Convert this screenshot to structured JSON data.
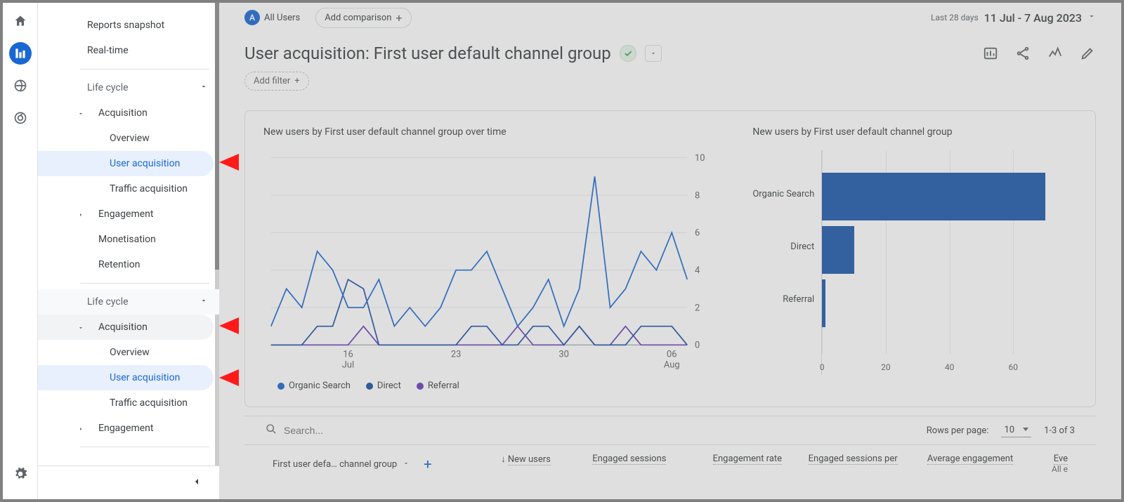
{
  "iconbar": {
    "home": "home-icon",
    "reports": "bar-chart-icon",
    "explore": "globe-trend-icon",
    "target": "target-icon",
    "settings": "gear-icon"
  },
  "sidebar": {
    "items": [
      {
        "label": "Reports snapshot",
        "level": 1,
        "selected": false,
        "interact": true
      },
      {
        "label": "Real-time",
        "level": 1,
        "selected": false,
        "interact": true
      }
    ],
    "group1": {
      "header": "Life cycle",
      "acquisition": "Acquisition",
      "overview": "Overview",
      "user_acq": "User acquisition",
      "traffic_acq": "Traffic acquisition",
      "engagement": "Engagement",
      "monetisation": "Monetisation",
      "retention": "Retention"
    },
    "group2": {
      "header": "Life cycle",
      "acquisition": "Acquisition",
      "overview": "Overview",
      "user_acq": "User acquisition",
      "traffic_acq": "Traffic acquisition",
      "engagement": "Engagement"
    }
  },
  "top": {
    "all_users_badge": "A",
    "all_users_label": "All Users",
    "add_comparison": "Add comparison",
    "date_label": "Last 28 days",
    "date_range": "11 Jul - 7 Aug 2023"
  },
  "title": {
    "text": "User acquisition: First user default channel group",
    "add_filter": "Add filter"
  },
  "chart_data": [
    {
      "type": "line",
      "title": "New users by First user default channel group over time",
      "x_ticks": [
        "16 Jul",
        "23",
        "30",
        "06 Aug"
      ],
      "ylim": [
        0,
        10
      ],
      "y_ticks": [
        0,
        2,
        4,
        6,
        8,
        10
      ],
      "series": [
        {
          "name": "Organic Search",
          "color": "#1967d2",
          "values": [
            1,
            3,
            2,
            5,
            4,
            2,
            2,
            3.5,
            1,
            2,
            1,
            2,
            4,
            4,
            5,
            3,
            1,
            2,
            3.5,
            1,
            3,
            9,
            2,
            3,
            5,
            4,
            6,
            3.5
          ]
        },
        {
          "name": "Direct",
          "color": "#174ea6",
          "values": [
            0,
            0,
            0,
            1,
            1,
            3.5,
            3,
            0,
            0,
            0,
            0,
            0,
            0,
            1,
            1,
            0,
            0,
            1,
            1,
            0,
            1,
            0,
            0,
            0,
            1,
            1,
            1,
            0
          ]
        },
        {
          "name": "Referral",
          "color": "#673ab7",
          "values": [
            0,
            0,
            0,
            0,
            0,
            0,
            1,
            0,
            0,
            0,
            0,
            0,
            0,
            0,
            0,
            0,
            1,
            0,
            0,
            0,
            1,
            0,
            0,
            1,
            0,
            0,
            0,
            0
          ]
        }
      ]
    },
    {
      "type": "bar",
      "title": "New users by First user default channel group",
      "categories": [
        "Organic Search",
        "Direct",
        "Referral"
      ],
      "values": [
        70,
        10,
        1
      ],
      "xlim": [
        0,
        80
      ],
      "x_ticks": [
        0,
        20,
        40,
        60
      ],
      "color": "#1a56aa"
    }
  ],
  "table": {
    "search_placeholder": "Search...",
    "rows_label": "Rows per page:",
    "rows_value": "10",
    "page_info": "1-3 of 3",
    "dim_label": "First user defa… channel group",
    "cols": [
      "New users",
      "Engaged sessions",
      "Engagement rate",
      "Engaged sessions per",
      "Average engagement",
      "Eve"
    ],
    "cols_sub": [
      "",
      "",
      "",
      "",
      "",
      "All e"
    ]
  }
}
